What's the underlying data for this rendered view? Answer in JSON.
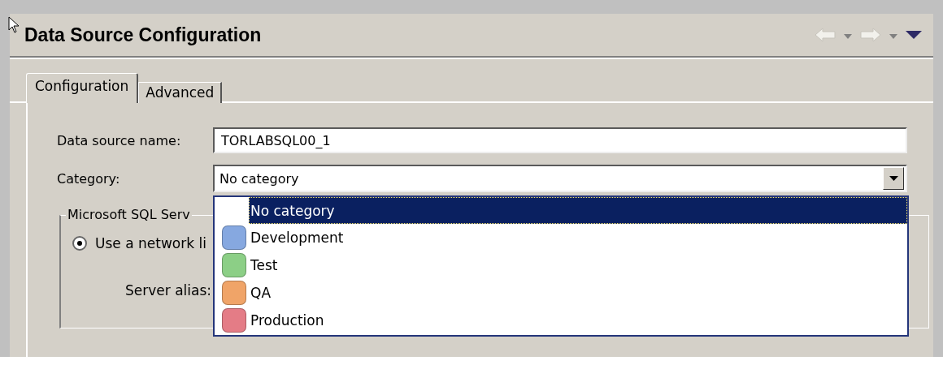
{
  "window": {
    "title": "Data Source Configuration"
  },
  "tabs": [
    {
      "label": "Configuration",
      "selected": true
    },
    {
      "label": "Advanced",
      "selected": false
    }
  ],
  "fields": [
    {
      "label": "Data source name:",
      "value": "TORLABSQL00_1"
    }
  ],
  "category": {
    "label": "Category:",
    "value": "No category",
    "expanded": true,
    "options": [
      {
        "label": "No category",
        "selected": true
      },
      {
        "label": "Development",
        "color": "#86a8e0",
        "selected": false
      },
      {
        "label": "Test",
        "color": "#8ccf86",
        "selected": false
      },
      {
        "label": "QA",
        "color": "#f0a468",
        "selected": false
      },
      {
        "label": "Production",
        "color": "#e47c86",
        "selected": false
      }
    ]
  },
  "group": {
    "title": "Microsoft SQL Serv",
    "options": [
      {
        "label": "Use a network li",
        "checked": true
      }
    ],
    "server_alias_label": "Server alias:"
  }
}
